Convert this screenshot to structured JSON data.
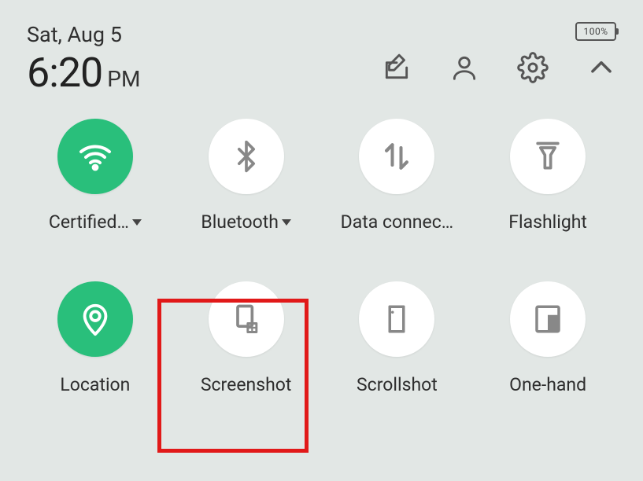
{
  "header": {
    "date": "Sat, Aug 5",
    "time": "6:20",
    "ampm": "PM",
    "battery_text": "100%"
  },
  "header_icons": {
    "edit": "edit-icon",
    "profile": "profile-icon",
    "settings": "settings-icon",
    "collapse": "chevron-up-icon"
  },
  "tiles": [
    {
      "id": "wifi",
      "label": "Certified…",
      "has_caret": true,
      "active": true
    },
    {
      "id": "bluetooth",
      "label": "Bluetooth",
      "has_caret": true,
      "active": false
    },
    {
      "id": "data",
      "label": "Data connec…",
      "has_caret": false,
      "active": false
    },
    {
      "id": "flashlight",
      "label": "Flashlight",
      "has_caret": false,
      "active": false
    },
    {
      "id": "location",
      "label": "Location",
      "has_caret": false,
      "active": true
    },
    {
      "id": "screenshot",
      "label": "Screenshot",
      "has_caret": false,
      "active": false,
      "highlighted": true
    },
    {
      "id": "scrollshot",
      "label": "Scrollshot",
      "has_caret": false,
      "active": false
    },
    {
      "id": "onehand",
      "label": "One-hand",
      "has_caret": false,
      "active": false
    }
  ],
  "colors": {
    "accent": "#29bf7b",
    "highlight": "#e11919"
  }
}
